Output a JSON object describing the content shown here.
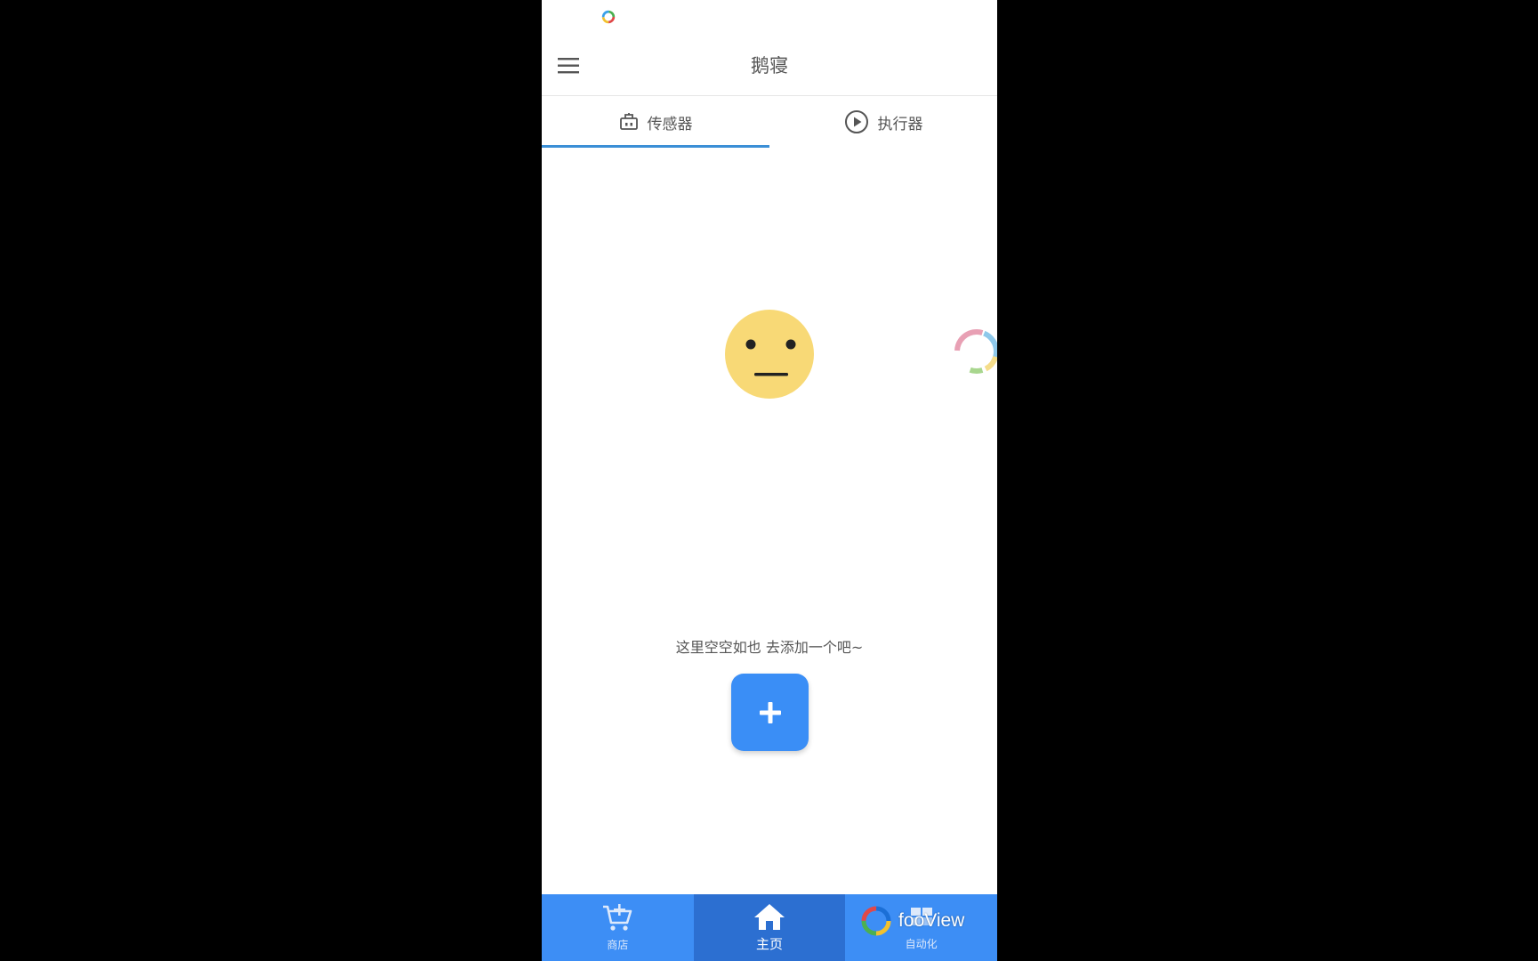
{
  "app": {
    "title": "鹅寝"
  },
  "tabs": [
    {
      "label": "传感器",
      "icon": "sensor-icon",
      "active": true
    },
    {
      "label": "执行器",
      "icon": "play-circle-icon",
      "active": false
    }
  ],
  "empty_state": {
    "icon": "neutral-face-icon",
    "message": "这里空空如也 去添加一个吧~",
    "add_button_icon": "plus-icon"
  },
  "bottom_nav": [
    {
      "label": "商店",
      "icon": "cart-add-icon",
      "active": false
    },
    {
      "label": "主页",
      "icon": "home-icon",
      "active": true
    },
    {
      "label": "自动化",
      "icon": "automation-icon",
      "active": false
    }
  ],
  "overlay": {
    "brand": "fooView"
  },
  "colors": {
    "accent": "#3b8fd6",
    "nav_background": "#3d8ef5",
    "nav_active": "#2c6fd1",
    "add_button": "#3a8ef6",
    "face": "#f8d976"
  }
}
